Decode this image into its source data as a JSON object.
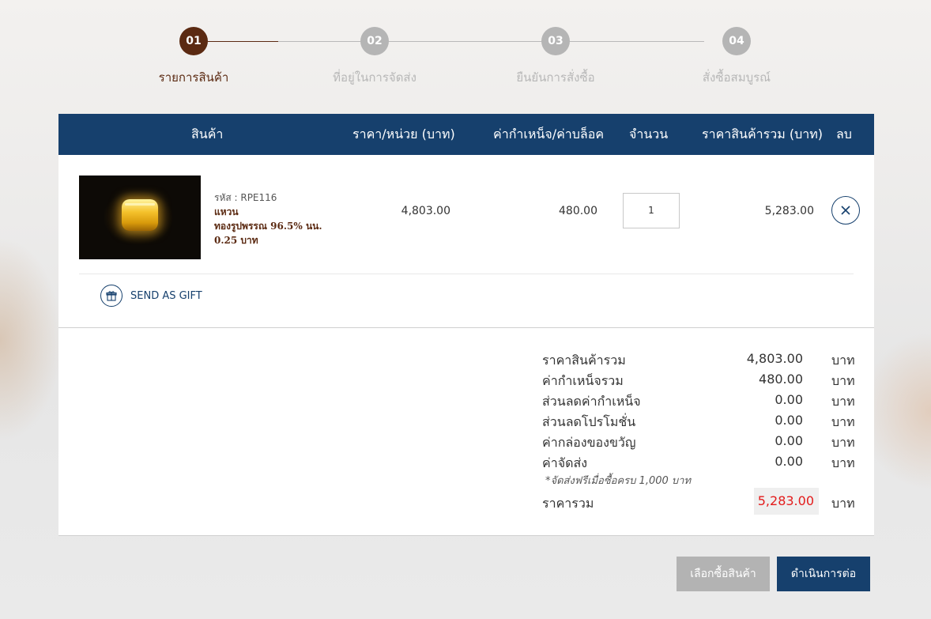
{
  "steps": [
    {
      "num": "01",
      "label": "รายการสินค้า"
    },
    {
      "num": "02",
      "label": "ที่อยู่ในการจัดส่ง"
    },
    {
      "num": "03",
      "label": "ยืนยันการสั่งซื้อ"
    },
    {
      "num": "04",
      "label": "สั่งซื้อสมบูรณ์"
    }
  ],
  "table_headers": {
    "product": "สินค้า",
    "unit_price": "ราคา/หน่วย (บาท)",
    "labor": "ค่ากำเหน็จ/ค่าบล็อค",
    "qty": "จำนวน",
    "total": "ราคาสินค้ารวม (บาท)",
    "delete": "ลบ"
  },
  "item": {
    "code": "รหัส : RPE116",
    "name_line1": "แหวน",
    "name_line2": "ทองรูปพรรณ 96.5% นน. 0.25 บาท",
    "unit_price": "4,803.00",
    "labor": "480.00",
    "qty": "1",
    "total": "5,283.00",
    "delete_icon": "close-icon"
  },
  "gift": {
    "label": "SEND AS GIFT",
    "icon": "gift-icon"
  },
  "summary": {
    "rows": [
      {
        "label": "ราคาสินค้ารวม",
        "value": "4,803.00",
        "unit": "บาท"
      },
      {
        "label": "ค่ากำเหน็จรวม",
        "value": "480.00",
        "unit": "บาท"
      },
      {
        "label": "ส่วนลดค่ากำเหน็จ",
        "value": "0.00",
        "unit": "บาท"
      },
      {
        "label": "ส่วนลดโปรโมชั่น",
        "value": "0.00",
        "unit": "บาท"
      },
      {
        "label": "ค่ากล่องของขวัญ",
        "value": "0.00",
        "unit": "บาท"
      },
      {
        "label": "ค่าจัดส่ง",
        "value": "0.00",
        "unit": "บาท"
      }
    ],
    "note": "*จัดส่งฟรีเมื่อซื้อครบ 1,000 บาท",
    "total_label": "ราคารวม",
    "total_value": "5,283.00",
    "total_unit": "บาท",
    "total_color": "#e31b1b"
  },
  "buttons": {
    "shop": "เลือกซื้อสินค้า",
    "continue": "ดำเนินการต่อ"
  },
  "colors": {
    "primary": "#16406d",
    "brand_brown": "#5b2a12",
    "inactive": "#b5b5b5"
  }
}
